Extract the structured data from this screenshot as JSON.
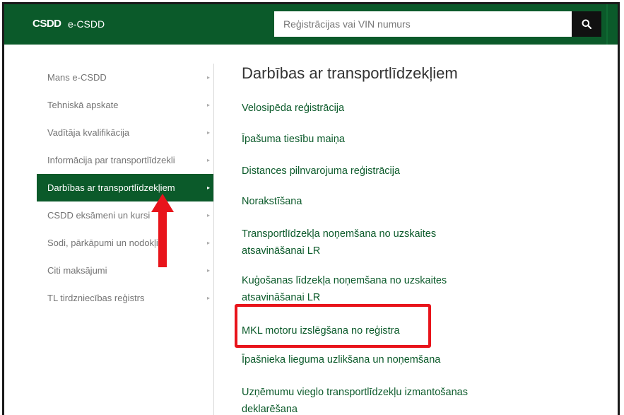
{
  "header": {
    "logo_text": "CSDD",
    "brand": "e-CSDD",
    "search": {
      "placeholder": "Reģistrācijas vai VIN numurs"
    }
  },
  "sidebar": {
    "items": [
      {
        "label": "Mans e-CSDD",
        "arrow": "▸"
      },
      {
        "label": "Tehniskā apskate",
        "arrow": "▸"
      },
      {
        "label": "Vadītāja kvalifikācija",
        "arrow": "▸"
      },
      {
        "label": "Informācija par transportlīdzekli",
        "arrow": "▸"
      },
      {
        "label": "Darbības ar transportlīdzekļiem",
        "arrow": "▸",
        "active": true
      },
      {
        "label": "CSDD eksāmeni un kursi",
        "arrow": "▸"
      },
      {
        "label": "Sodi, pārkāpumi un nodokļi",
        "arrow": "▸"
      },
      {
        "label": "Citi maksājumi",
        "arrow": "▸"
      },
      {
        "label": "TL tirdzniecības reģistrs",
        "arrow": "▸"
      }
    ]
  },
  "main": {
    "title": "Darbības ar transportlīdzekļiem",
    "links": [
      "Velosipēda reģistrācija",
      "Īpašuma tiesību maiņa",
      "Distances pilnvarojuma reģistrācija",
      "Norakstīšana",
      "Transportlīdzekļa noņemšana no uzskaites atsavināšanai LR",
      "Kuģošanas līdzekļa noņemšana no uzskaites atsavināšanai LR",
      "MKL motoru izslēgšana no reģistra",
      "Īpašnieka lieguma uzlikšana un noņemšana",
      "Uzņēmumu vieglo transportlīdzekļu izmantošanas deklarēšana"
    ]
  },
  "colors": {
    "brand_green": "#0b5a2a",
    "highlight_red": "#e8141b"
  }
}
